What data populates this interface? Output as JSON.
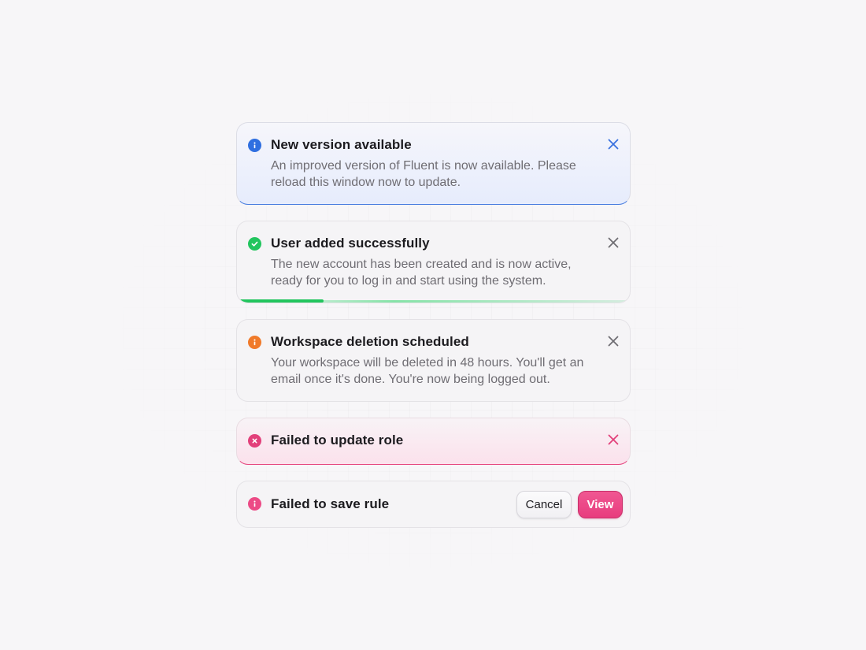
{
  "colors": {
    "info": "#2f6fe0",
    "success": "#22c55e",
    "warning": "#f07a2a",
    "error": "#e2407a",
    "primary_button": "#ec4b86"
  },
  "toasts": [
    {
      "type": "info",
      "icon": "info-icon",
      "title": "New version available",
      "body": "An improved version of Fluent is now available. Please reload this window now to update.",
      "close_icon": "close-icon"
    },
    {
      "type": "success",
      "icon": "check-circle-icon",
      "title": "User added successfully",
      "body": "The new account has been created and is now active, ready for you to log in and start using the system.",
      "close_icon": "close-icon",
      "progress": 0.22
    },
    {
      "type": "warning",
      "icon": "info-icon",
      "title": "Workspace deletion scheduled",
      "body": "Your workspace will be deleted in 48 hours. You'll get an email once it's done. You're now being logged out.",
      "close_icon": "close-icon"
    },
    {
      "type": "error",
      "icon": "x-circle-icon",
      "title": "Failed to update role",
      "close_icon": "close-icon"
    },
    {
      "type": "error",
      "icon": "info-icon",
      "title": "Failed to save rule",
      "actions": {
        "cancel": "Cancel",
        "view": "View"
      }
    }
  ]
}
